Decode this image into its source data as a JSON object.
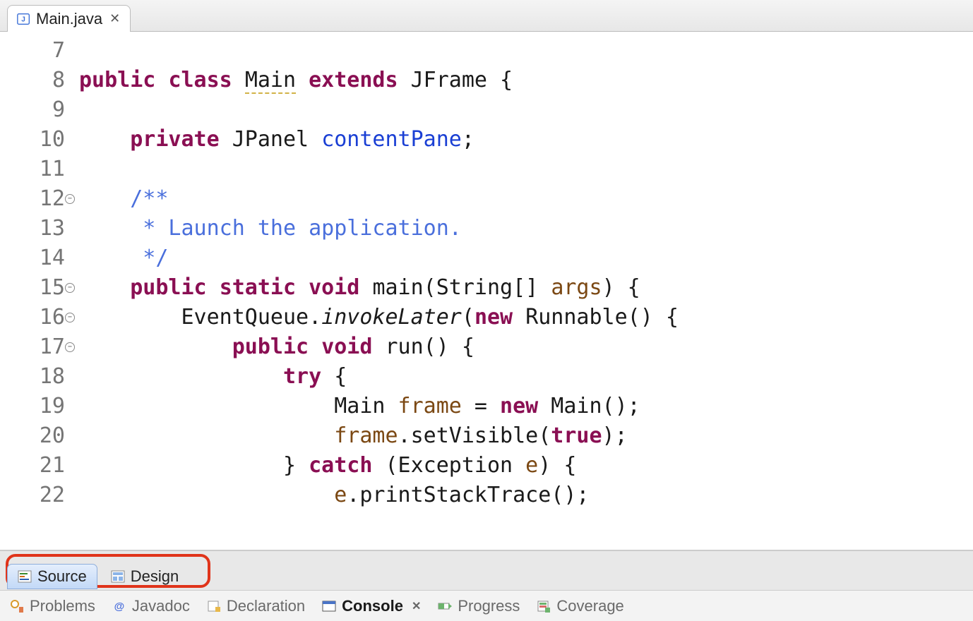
{
  "tab": {
    "filename": "Main.java"
  },
  "mode_tabs": {
    "source": "Source",
    "design": "Design",
    "active": "source"
  },
  "views": {
    "problems": "Problems",
    "javadoc": "Javadoc",
    "declaration": "Declaration",
    "console": "Console",
    "progress": "Progress",
    "coverage": "Coverage",
    "active": "console"
  },
  "code": {
    "lines": [
      {
        "num": 7,
        "tokens": []
      },
      {
        "num": 8,
        "warn": true,
        "tokens": [
          {
            "t": "public ",
            "c": "kw"
          },
          {
            "t": "class ",
            "c": "kw"
          },
          {
            "t": "Main",
            "c": "cls underline-dash"
          },
          {
            "t": " "
          },
          {
            "t": "extends ",
            "c": "kw"
          },
          {
            "t": "JFrame {",
            "c": "type"
          }
        ]
      },
      {
        "num": 9,
        "tokens": []
      },
      {
        "num": 10,
        "indent": 1,
        "tokens": [
          {
            "t": "private ",
            "c": "kw"
          },
          {
            "t": "JPanel ",
            "c": "type"
          },
          {
            "t": "contentPane",
            "c": "field"
          },
          {
            "t": ";"
          }
        ]
      },
      {
        "num": 11,
        "tokens": []
      },
      {
        "num": 12,
        "fold": true,
        "indent": 1,
        "tokens": [
          {
            "t": "/**",
            "c": "doc"
          }
        ]
      },
      {
        "num": 13,
        "indent": 1,
        "tokens": [
          {
            "t": " * Launch the application.",
            "c": "doc"
          }
        ]
      },
      {
        "num": 14,
        "indent": 1,
        "tokens": [
          {
            "t": " */",
            "c": "doc"
          }
        ]
      },
      {
        "num": 15,
        "fold": true,
        "indent": 1,
        "tokens": [
          {
            "t": "public ",
            "c": "kw"
          },
          {
            "t": "static ",
            "c": "kw"
          },
          {
            "t": "void ",
            "c": "kw"
          },
          {
            "t": "main(String[] ",
            "c": "type"
          },
          {
            "t": "args",
            "c": "param"
          },
          {
            "t": ") {",
            "c": "type"
          }
        ]
      },
      {
        "num": 16,
        "fold": true,
        "indent": 2,
        "tokens": [
          {
            "t": "EventQueue."
          },
          {
            "t": "invokeLater",
            "c": "method-italic"
          },
          {
            "t": "("
          },
          {
            "t": "new ",
            "c": "kw"
          },
          {
            "t": "Runnable() {"
          }
        ]
      },
      {
        "num": 17,
        "fold": true,
        "override": true,
        "indent": 3,
        "tokens": [
          {
            "t": "public ",
            "c": "kw"
          },
          {
            "t": "void ",
            "c": "kw"
          },
          {
            "t": "run() {"
          }
        ]
      },
      {
        "num": 18,
        "indent": 4,
        "tokens": [
          {
            "t": "try ",
            "c": "kw"
          },
          {
            "t": "{"
          }
        ]
      },
      {
        "num": 19,
        "indent": 5,
        "tokens": [
          {
            "t": "Main "
          },
          {
            "t": "frame",
            "c": "param"
          },
          {
            "t": " = "
          },
          {
            "t": "new ",
            "c": "kw"
          },
          {
            "t": "Main();"
          }
        ]
      },
      {
        "num": 20,
        "indent": 5,
        "tokens": [
          {
            "t": "frame",
            "c": "param"
          },
          {
            "t": ".setVisible("
          },
          {
            "t": "true",
            "c": "kw"
          },
          {
            "t": ");"
          }
        ]
      },
      {
        "num": 21,
        "indent": 4,
        "tokens": [
          {
            "t": "} "
          },
          {
            "t": "catch ",
            "c": "kw"
          },
          {
            "t": "(Exception "
          },
          {
            "t": "e",
            "c": "param"
          },
          {
            "t": ") {"
          }
        ]
      },
      {
        "num": 22,
        "indent": 5,
        "tokens": [
          {
            "t": "e",
            "c": "param"
          },
          {
            "t": ".printStackTrace();"
          }
        ]
      }
    ]
  }
}
